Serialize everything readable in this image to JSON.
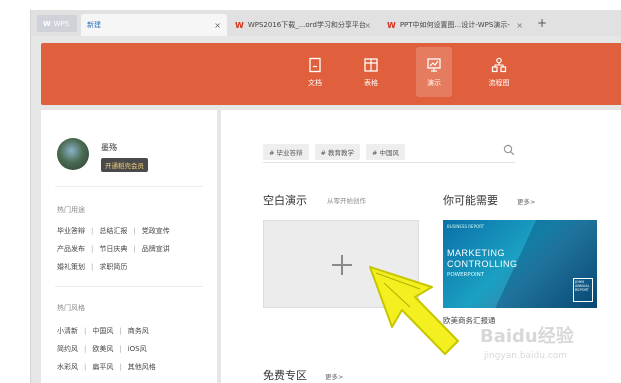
{
  "tabs": {
    "app_label": "WPS",
    "active_label": "新建",
    "doc_label": "WPS2016下载_...ord学习和分享平台",
    "ppt_label": "PPT中如何设置图...设计-WPS演示-",
    "close": "×",
    "new_tab": "+"
  },
  "header": {
    "items": [
      {
        "label": "文档",
        "icon": "doc-icon"
      },
      {
        "label": "表格",
        "icon": "table-icon"
      },
      {
        "label": "演示",
        "icon": "presentation-icon"
      },
      {
        "label": "流程图",
        "icon": "flowchart-icon"
      }
    ],
    "active_index": 2,
    "color": "#e0603e"
  },
  "sidebar": {
    "username": "墨殇",
    "member_badge": "开通稻壳会员",
    "hot_use_title": "热门用途",
    "hot_use_rows": [
      [
        "毕业答辩",
        "总结汇报",
        "党政宣传"
      ],
      [
        "产品发布",
        "节日庆典",
        "品牌宣讲"
      ],
      [
        "婚礼策划",
        "求职简历"
      ]
    ],
    "hot_style_title": "热门风格",
    "hot_style_rows": [
      [
        "小清新",
        "中国风",
        "商务风"
      ],
      [
        "简约风",
        "欧美风",
        "iOS风"
      ],
      [
        "水彩风",
        "扁平风",
        "其他风格"
      ]
    ]
  },
  "main": {
    "chips": [
      "# 毕业答辩",
      "# 教育教学",
      "# 中国风"
    ],
    "blank_title": "空白演示",
    "blank_sub": "从零开始创作",
    "need_title": "你可能需要",
    "more": "更多>",
    "template": {
      "small_text": "BUSINESS REPORT",
      "headline_1": "MARKETING",
      "headline_2": "CONTROLLING",
      "sub": "POWERPOINT",
      "box_text": "JOHN ANNUAL REPORT",
      "caption": "欧美商务汇报通"
    },
    "free_title": "免费专区",
    "free_more": "更多>"
  },
  "watermark": {
    "brand": "Baidu经验",
    "url": "jingyan.baidu.com"
  }
}
